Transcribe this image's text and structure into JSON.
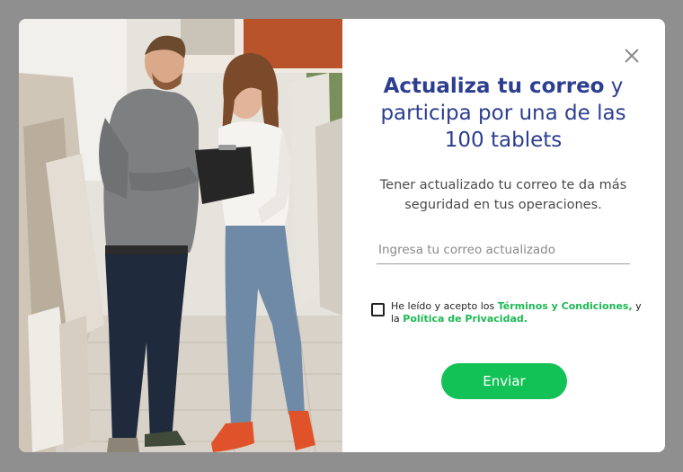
{
  "modal": {
    "photo_alt": "Pareja revisando cerámicos en una tienda",
    "title_bold": "Actualiza tu correo",
    "title_rest": " y participa por una de las 100 tablets",
    "description": "Tener actualizado tu correo te da más seguridad en tus operaciones.",
    "email_placeholder": "Ingresa tu correo actualizado",
    "email_value": "",
    "consent_prefix": "He leído y acepto los ",
    "terms_link": "Términos y Condiciones,",
    "consent_middle": " y la ",
    "privacy_link": "Política de Privacidad.",
    "consent_checked": false,
    "submit_label": "Enviar"
  },
  "colors": {
    "overlay": "#8f8f8f",
    "title": "#2c3e8f",
    "link": "#1db954",
    "button": "#12c257"
  },
  "icons": {
    "close": "close-icon"
  }
}
